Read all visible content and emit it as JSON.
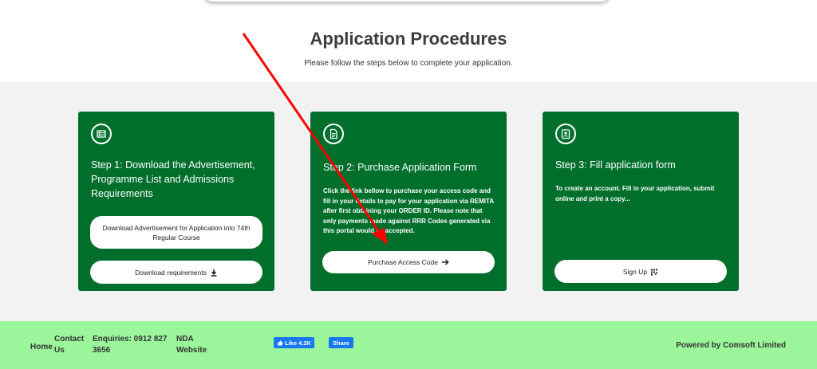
{
  "header": {
    "title": "Application Procedures",
    "subtitle": "Please follow the steps below to complete your application."
  },
  "steps": [
    {
      "icon": "list-icon",
      "title": "Step 1: Download the Advertisement, Programme List and Admissions Requirements",
      "buttons": [
        {
          "label": "Download Advertisement for Application into 74th Regular Course"
        },
        {
          "label": "Download requirements",
          "icon": "download-icon"
        }
      ]
    },
    {
      "icon": "document-icon",
      "title": "Step 2: Purchase Application Form",
      "description": "Click the link bellow to purchase your access code and fill in your details to pay for your application via REMITA after first obtaining your ORDER ID. Please note that only payments made against RRR Codes generated via this portal would be accepted.",
      "buttons": [
        {
          "label": "Purchase Access Code",
          "icon": "arrow-right-icon"
        }
      ]
    },
    {
      "icon": "id-badge-icon",
      "title": "Step 3: Fill application form",
      "description": "To create an account. Fill in your application, submit online and print a copy...",
      "buttons": [
        {
          "label": "Sign Up",
          "icon": "signup-icon"
        }
      ]
    }
  ],
  "footer": {
    "home": "Home",
    "contact": "Contact Us",
    "enquiries": "Enquiries: 0912 827 3656",
    "nda": "NDA Website",
    "fb_like": "Like 4.2K",
    "fb_share": "Share",
    "powered_by": "Powered by Comsoft Limited"
  },
  "colors": {
    "card_green": "#006f2c",
    "footer_green": "#9bf59b",
    "annotation_red": "#ff0000",
    "facebook_blue": "#1877f2"
  }
}
